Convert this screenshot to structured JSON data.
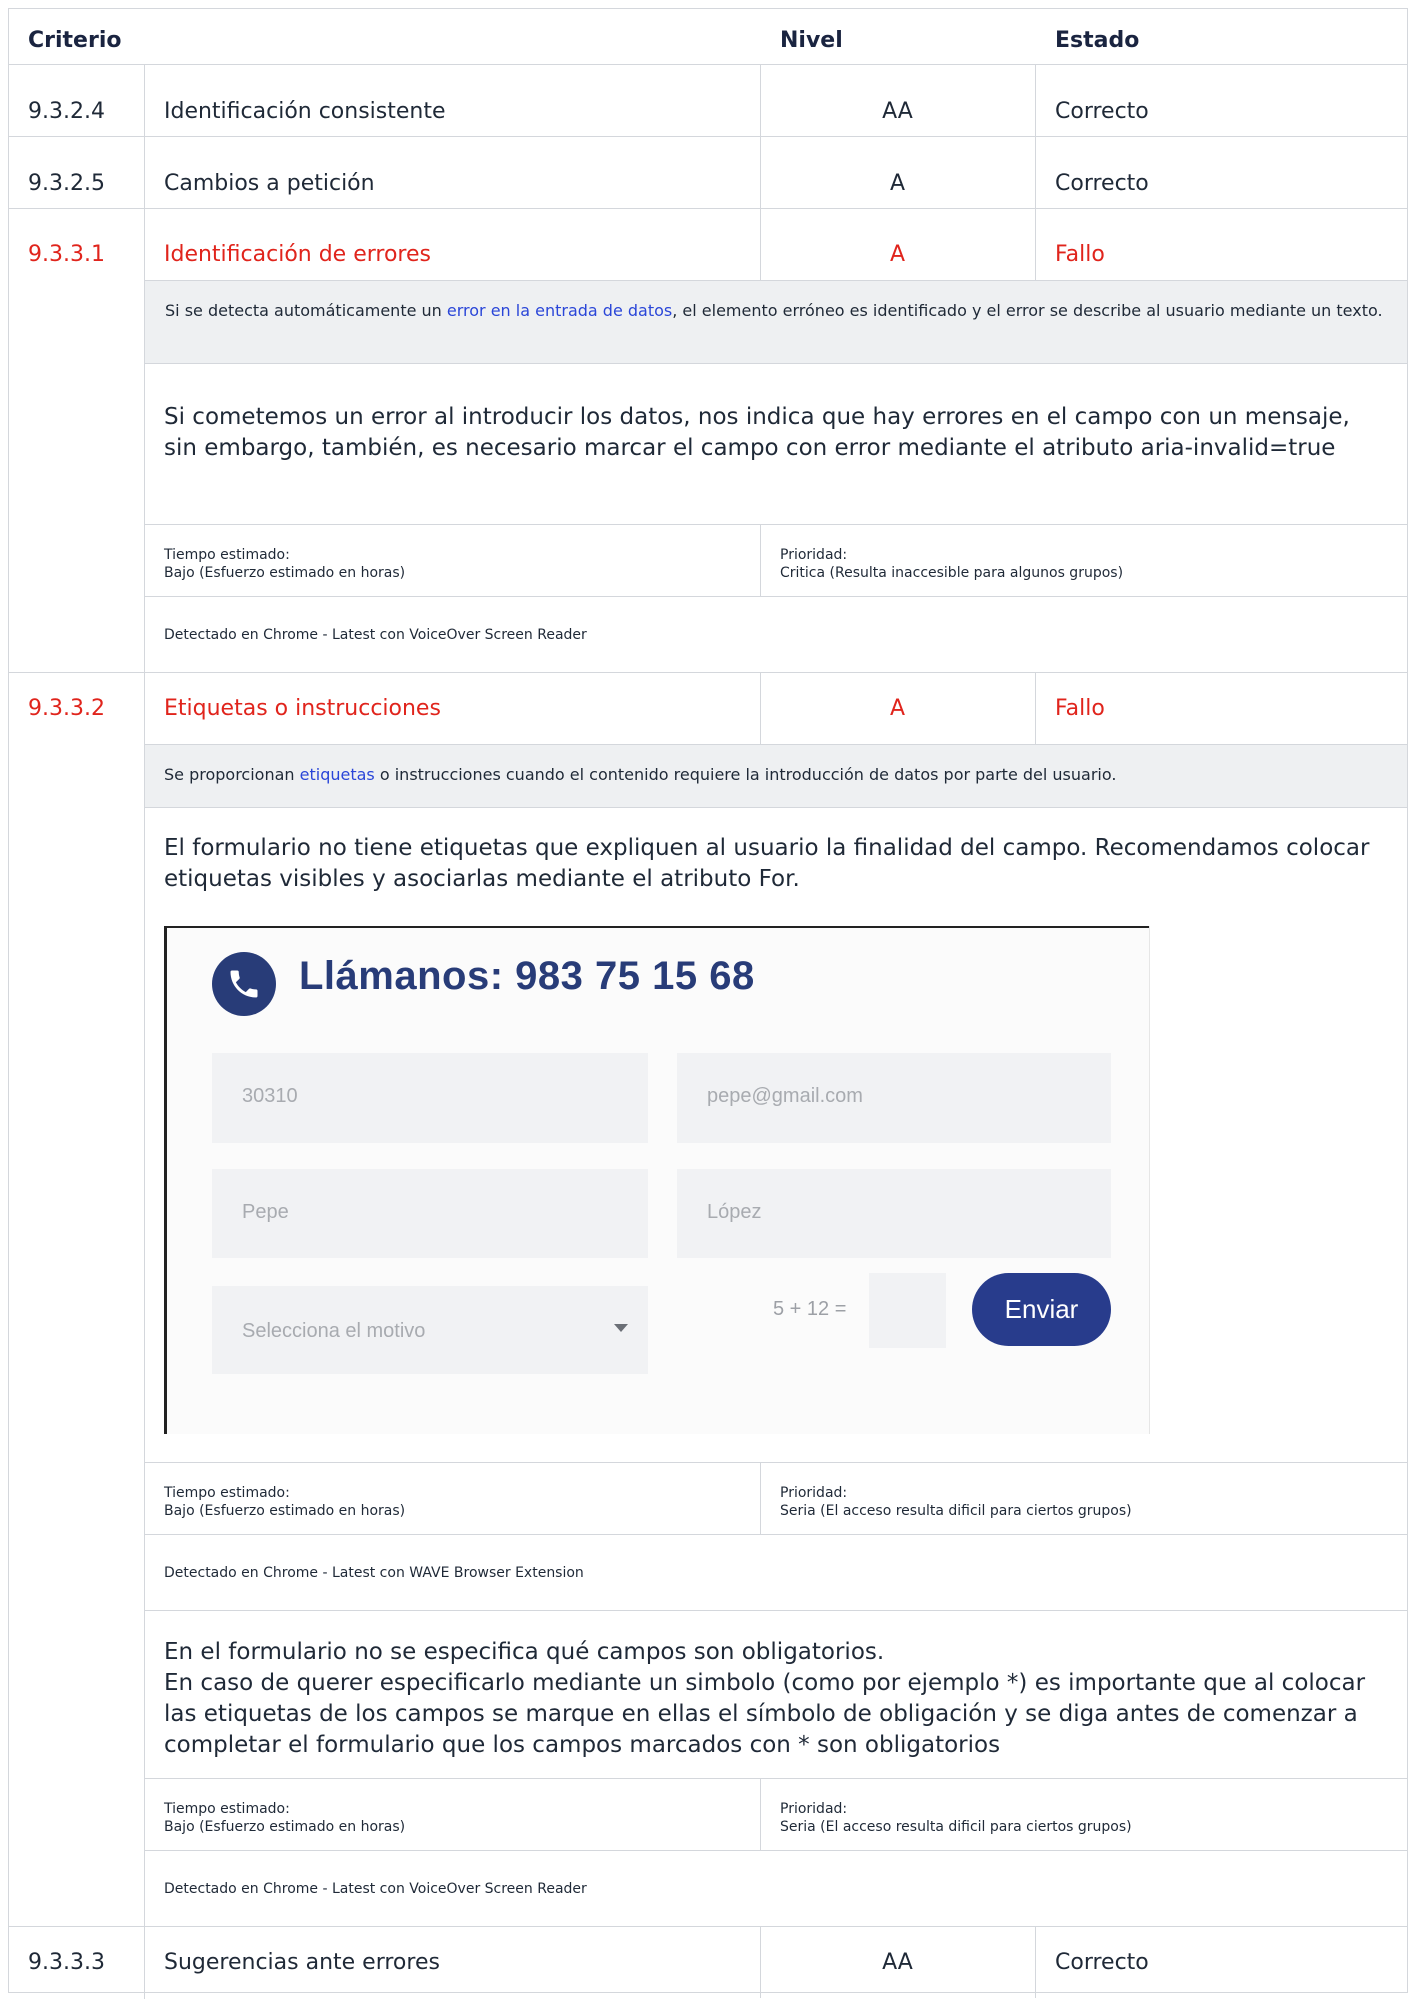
{
  "header": {
    "criterio": "Criterio",
    "nivel": "Nivel",
    "estado": "Estado"
  },
  "rows": [
    {
      "id": "9.3.2.4",
      "name": "Identificación consistente",
      "level": "AA",
      "status": "Correcto"
    },
    {
      "id": "9.3.2.5",
      "name": "Cambios a petición",
      "level": "A",
      "status": "Correcto"
    },
    {
      "id": "9.3.3.1",
      "name": "Identificación de errores",
      "level": "A",
      "status": "Fallo"
    },
    {
      "id": "9.3.3.2",
      "name": "Etiquetas o instrucciones",
      "level": "A",
      "status": "Fallo"
    },
    {
      "id": "9.3.3.3",
      "name": "Sugerencias ante errores",
      "level": "AA",
      "status": "Correcto"
    }
  ],
  "r3": {
    "desc_before": "Si se detecta automáticamente un ",
    "desc_link": "error en la entrada de datos",
    "desc_after": ", el elemento erróneo es identificado y el error se describe al usuario mediante un texto.",
    "observation": "Si cometemos un error al introducir los datos, nos indica que hay errores en el campo con un mensaje, sin embargo, también, es necesario marcar el campo con error mediante el atributo aria-invalid=true",
    "time_label": "Tiempo estimado:",
    "time_value": "Bajo (Esfuerzo estimado en horas)",
    "priority_label": "Prioridad:",
    "priority_value": "Critica (Resulta inaccesible para algunos grupos)",
    "detected": "Detectado en Chrome - Latest con VoiceOver Screen Reader"
  },
  "r4": {
    "desc_before": "Se proporcionan ",
    "desc_link": "etiquetas",
    "desc_after": " o instrucciones cuando el contenido requiere la introducción de datos por parte del usuario.",
    "observation1": "El formulario no tiene etiquetas que expliquen al usuario la finalidad del campo. Recomendamos colocar etiquetas visibles y asociarlas mediante el atributo For.",
    "time_label_1": "Tiempo estimado:",
    "time_value_1": "Bajo (Esfuerzo estimado en horas)",
    "priority_label_1": "Prioridad:",
    "priority_value_1": "Seria (El acceso resulta dificil para ciertos grupos)",
    "detected_1": "Detectado en Chrome - Latest con WAVE Browser Extension",
    "observation2_line1": "En el formulario no se especifica qué campos son obligatorios.",
    "observation2_line2": "En caso de querer especificarlo mediante un simbolo (como por ejemplo *) es importante que al colocar las etiquetas de los campos se marque en ellas el símbolo de obligación y se diga antes de comenzar a completar el formulario que los campos marcados con * son obligatorios",
    "time_label_2": "Tiempo estimado:",
    "time_value_2": "Bajo (Esfuerzo estimado en horas)",
    "priority_label_2": "Prioridad:",
    "priority_value_2": "Seria (El acceso resulta dificil para ciertos grupos)",
    "detected_2": "Detectado en Chrome - Latest con VoiceOver Screen Reader"
  },
  "screenshot": {
    "heading": "Llámanos:  983 75 15 68",
    "field_postal": "30310",
    "field_email": "pepe@gmail.com",
    "field_name": "Pepe",
    "field_surname": "López",
    "select_reason": "Selecciona el motivo",
    "captcha": "5 + 12 =",
    "send": "Enviar"
  }
}
